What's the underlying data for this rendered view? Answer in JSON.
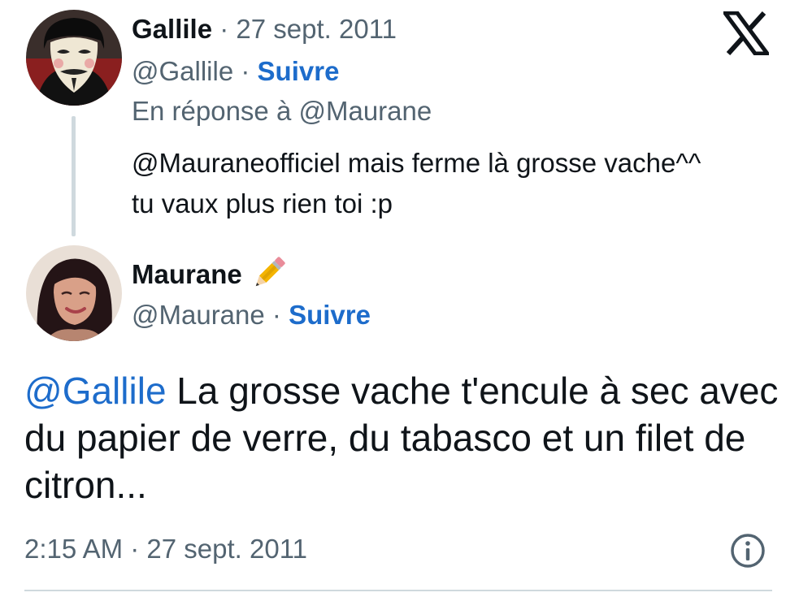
{
  "quoted_tweet": {
    "author_name": "Gallile",
    "separator": "·",
    "date": "27 sept. 2011",
    "handle": "@Gallile",
    "handle_separator": "·",
    "follow_label": "Suivre",
    "reply_to": "En réponse à @Maurane",
    "text_line1": "@Mauraneofficiel mais ferme là grosse vache^^",
    "text_line2": "tu vaux plus rien toi :p"
  },
  "main_tweet": {
    "author_name": "Maurane",
    "handle": "@Maurane",
    "handle_separator": "·",
    "follow_label": "Suivre",
    "mention": "@Gallile",
    "text": " La grosse vache t'encule à sec avec du papier de verre, du tabasco et un filet de citron...",
    "time": "2:15 AM",
    "time_separator": "·",
    "date": "27 sept. 2011"
  },
  "colors": {
    "link_blue": "#1d6ccb",
    "muted_gray": "#536471",
    "text_black": "#0f1419",
    "divider": "#cfd9de"
  },
  "icons": {
    "brand": "x-logo-icon",
    "badge": "pencil-emoji-icon",
    "info": "info-circle-icon"
  }
}
